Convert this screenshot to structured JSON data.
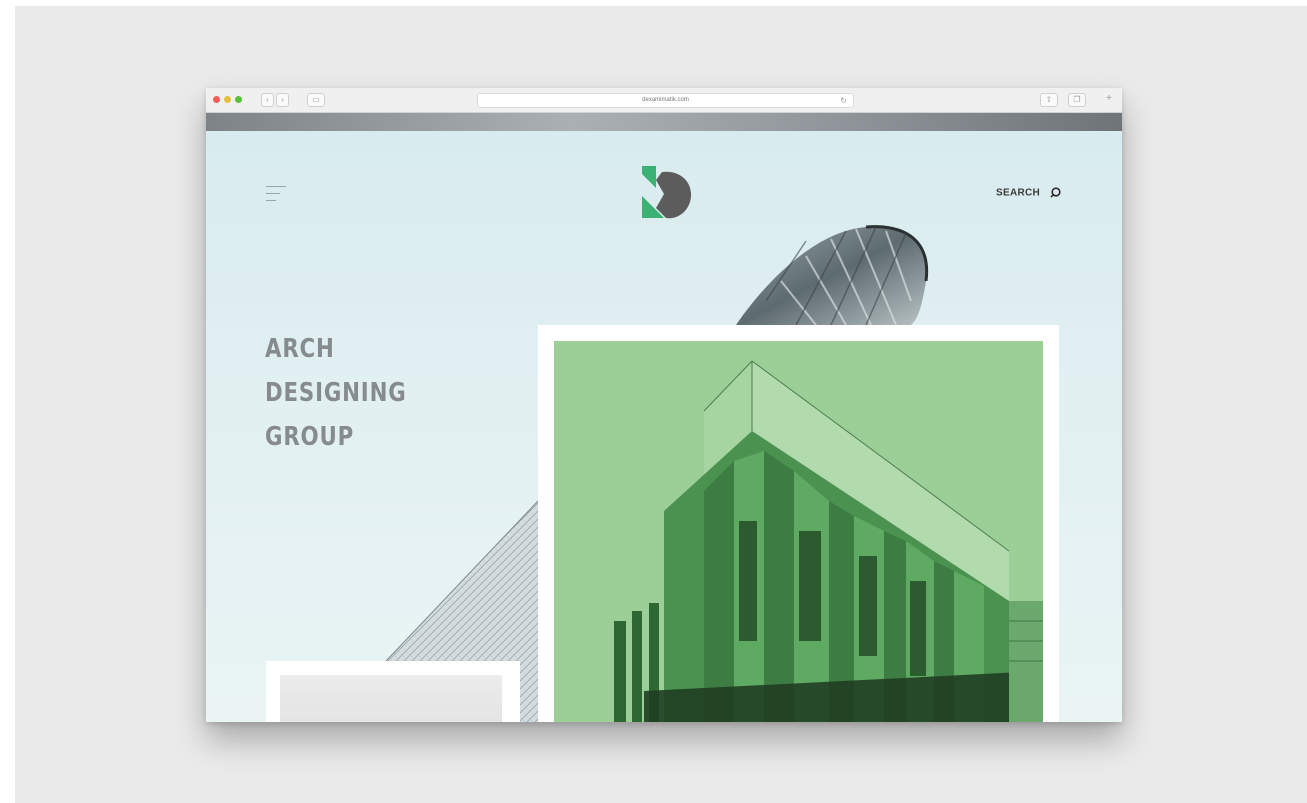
{
  "browser": {
    "url": "dexamimatik.com",
    "reload_glyph": "↻",
    "back_glyph": "‹",
    "forward_glyph": "›",
    "sidebar_glyph": "▭",
    "share_glyph": "⇧",
    "tabs_glyph": "❐",
    "newtab_glyph": "+"
  },
  "header": {
    "search_label": "SEARCH"
  },
  "hero": {
    "title_lines": [
      "ARCH",
      "DESIGNING",
      "GROUP"
    ]
  },
  "colors": {
    "logo_green": "#3bb273",
    "logo_gray": "#5c5c5c",
    "photo_green": "#5fae62",
    "title_gray": "#858b8e"
  }
}
